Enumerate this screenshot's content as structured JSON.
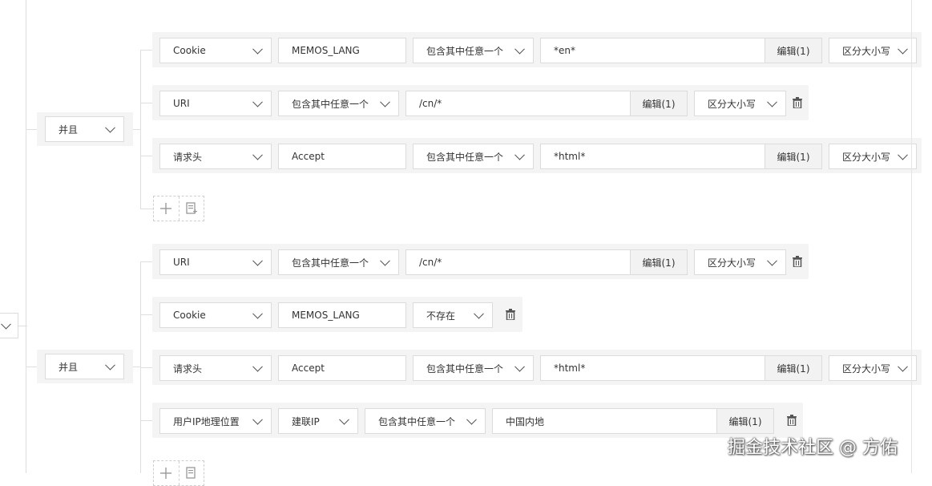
{
  "group1": {
    "operator": "并且",
    "rows": [
      {
        "field": "Cookie",
        "name": "MEMOS_LANG",
        "match": "包含其中任意一个",
        "value": "*en*",
        "edit_label": "编辑(1)",
        "case": "区分大小写"
      },
      {
        "field": "URI",
        "match": "包含其中任意一个",
        "value": "/cn/*",
        "edit_label": "编辑(1)",
        "case": "区分大小写"
      },
      {
        "field": "请求头",
        "name": "Accept",
        "match": "包含其中任意一个",
        "value": "*html*",
        "edit_label": "编辑(1)",
        "case": "区分大小写"
      }
    ]
  },
  "group2": {
    "operator": "并且",
    "rows": [
      {
        "field": "URI",
        "match": "包含其中任意一个",
        "value": "/cn/*",
        "edit_label": "编辑(1)",
        "case": "区分大小写"
      },
      {
        "field": "Cookie",
        "name": "MEMOS_LANG",
        "match": "不存在"
      },
      {
        "field": "请求头",
        "name": "Accept",
        "match": "包含其中任意一个",
        "value": "*html*",
        "edit_label": "编辑(1)",
        "case": "区分大小写"
      },
      {
        "field": "用户IP地理位置",
        "ip_type": "建联IP",
        "match": "包含其中任意一个",
        "value": "中国内地",
        "edit_label": "编辑(1)"
      }
    ]
  },
  "icons": {
    "add": "plus-icon",
    "add_group": "add-group-icon",
    "delete": "trash-icon",
    "dropdown": "chevron-down-icon"
  },
  "watermark": "掘金技术社区 @ 方佑"
}
